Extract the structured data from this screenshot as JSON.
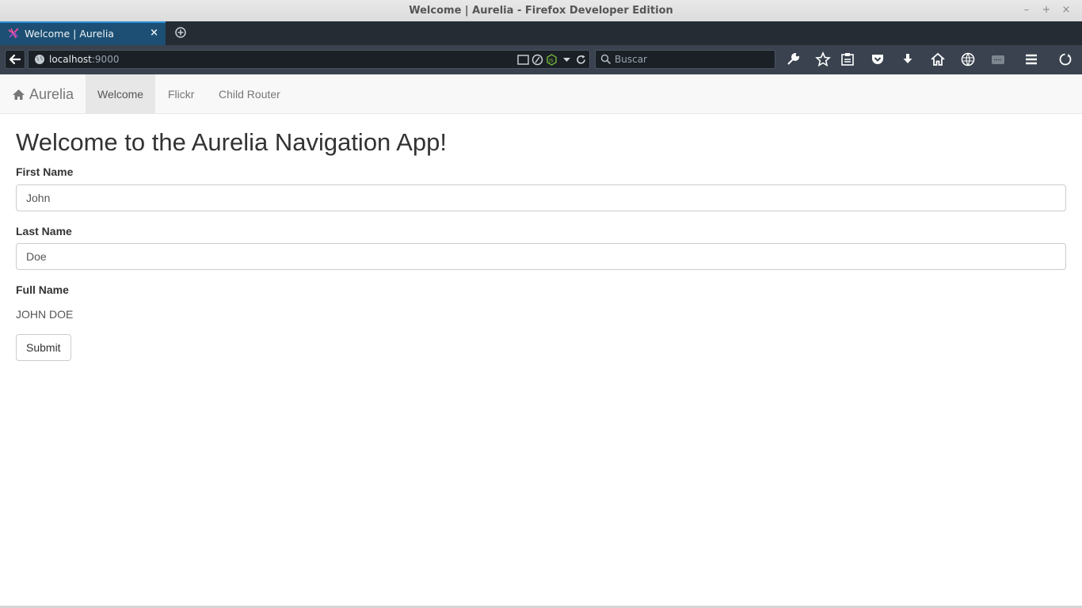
{
  "window": {
    "title": "Welcome | Aurelia - Firefox Developer Edition",
    "controls": {
      "minimize": "–",
      "maximize": "+",
      "close": "×"
    }
  },
  "tabs": [
    {
      "label": "Welcome | Aurelia",
      "close": "×",
      "favicon": "aurelia-logo-icon"
    }
  ],
  "address": {
    "host": "localhost",
    "port": ":9000"
  },
  "search": {
    "placeholder": "Buscar"
  },
  "toolbar_icons": [
    "wrench-icon",
    "star-icon",
    "reading-list-icon",
    "pocket-icon",
    "download-icon",
    "home-icon",
    "network-icon",
    "screenshot-icon",
    "menu-icon",
    "sync-icon"
  ],
  "app": {
    "brand": "Aurelia",
    "nav": [
      {
        "label": "Welcome",
        "active": true
      },
      {
        "label": "Flickr",
        "active": false
      },
      {
        "label": "Child Router",
        "active": false
      }
    ],
    "heading": "Welcome to the Aurelia Navigation App!",
    "form": {
      "first_name_label": "First Name",
      "first_name_value": "John",
      "last_name_label": "Last Name",
      "last_name_value": "Doe",
      "full_name_label": "Full Name",
      "full_name_value": "JOHN DOE",
      "submit_label": "Submit"
    }
  }
}
